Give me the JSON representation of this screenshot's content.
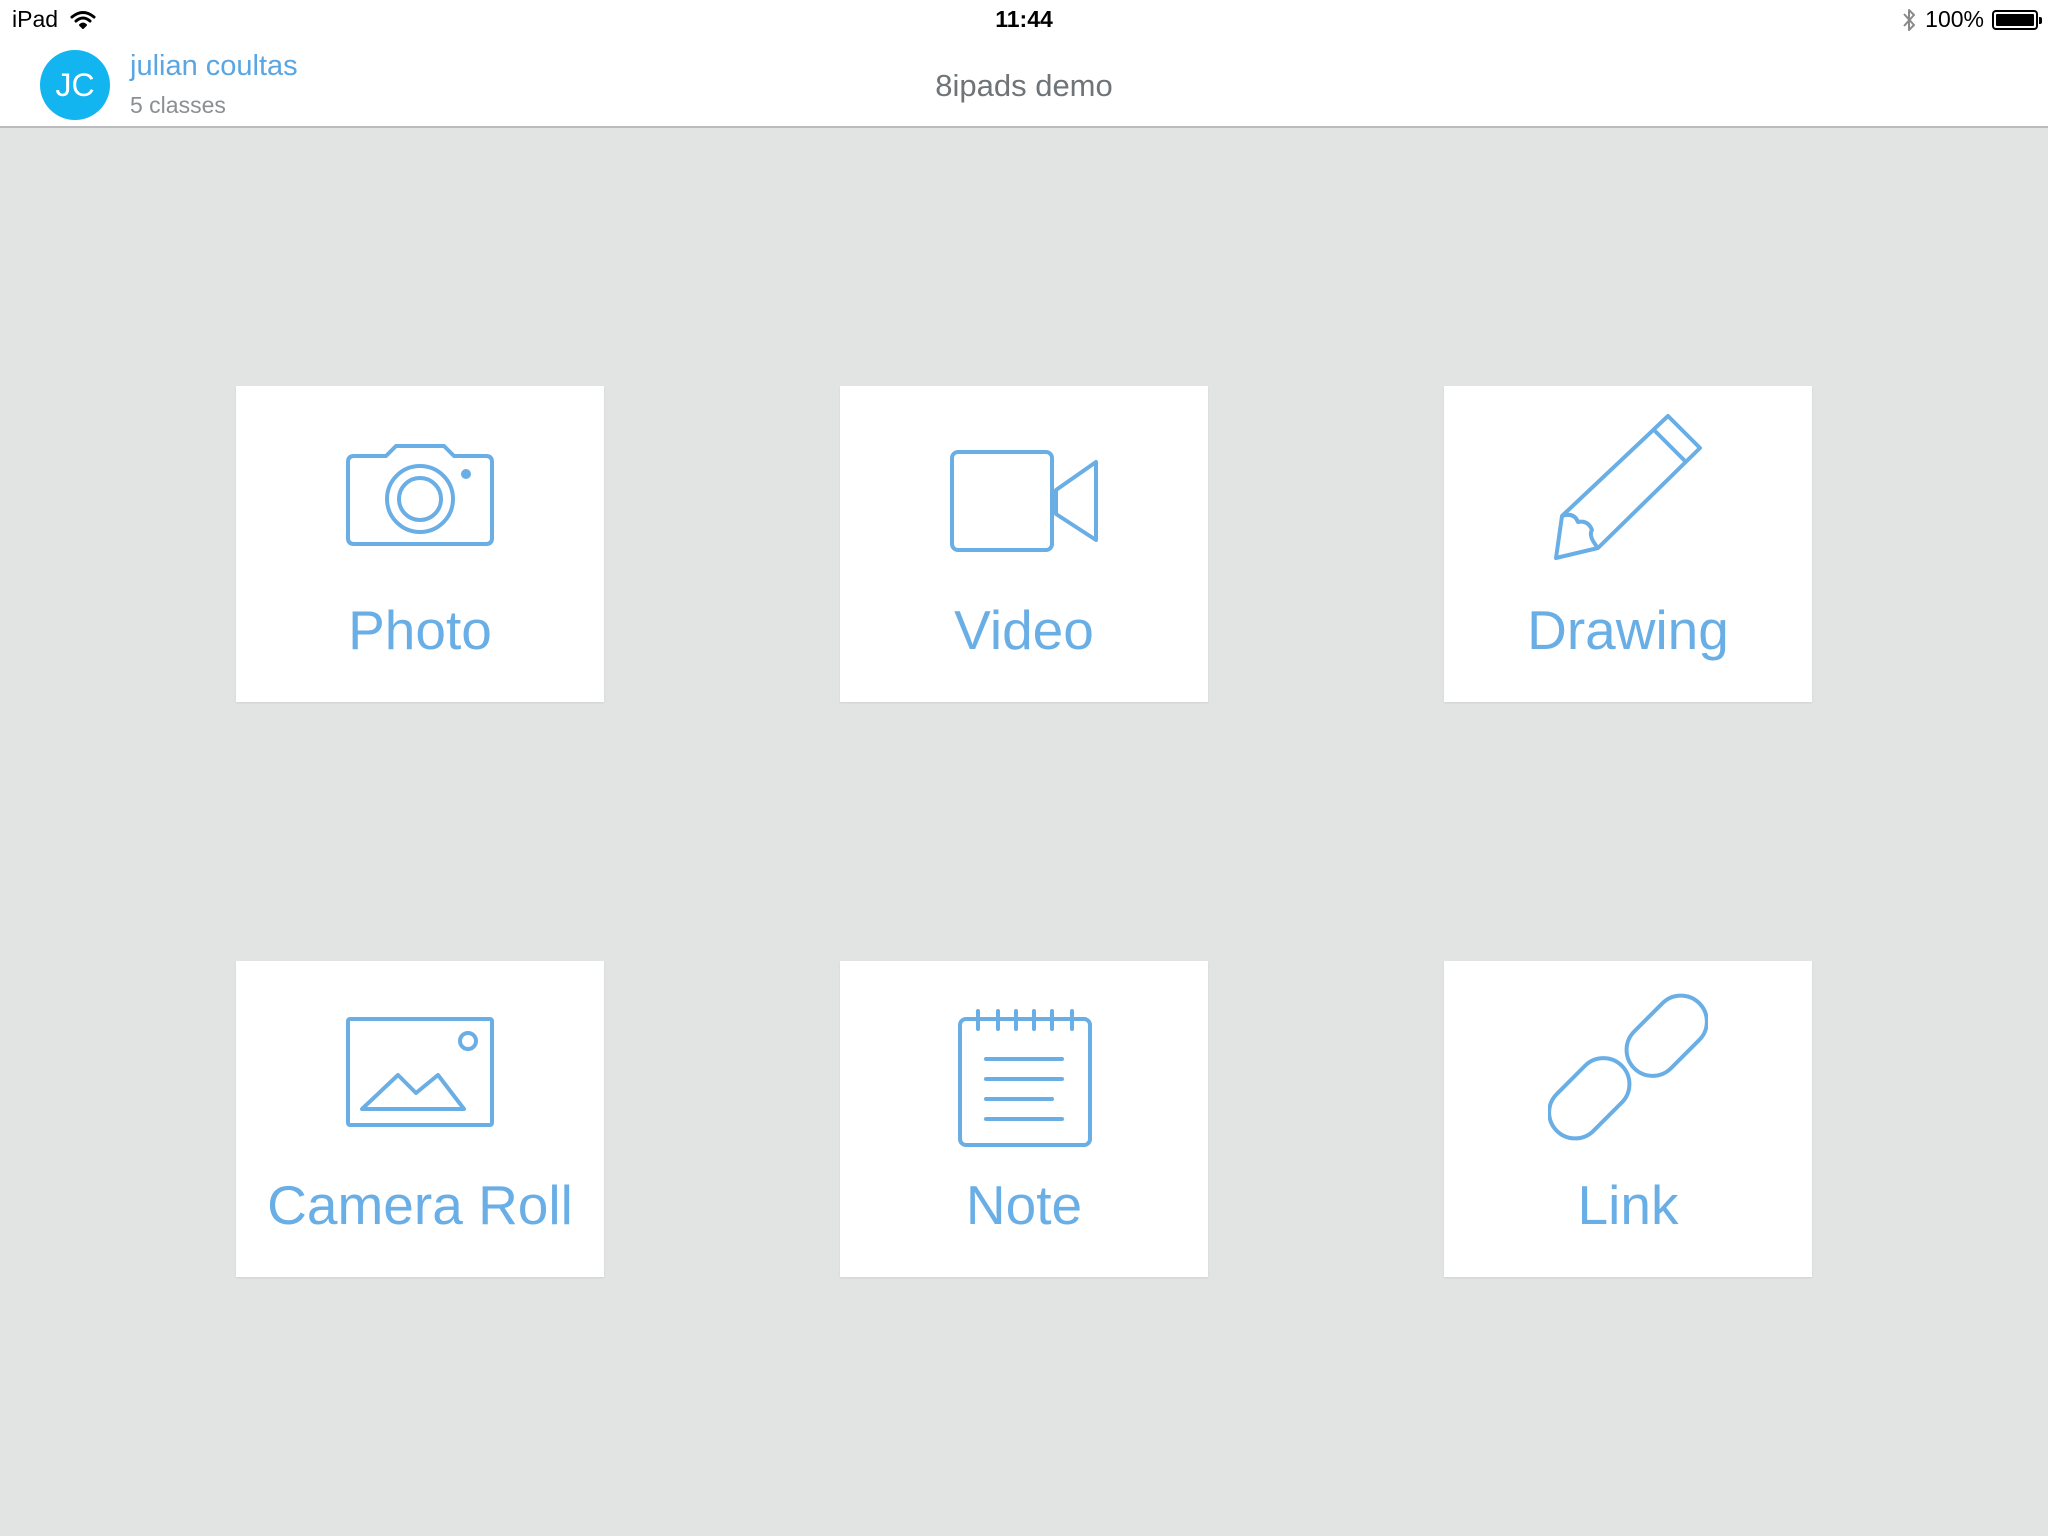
{
  "status_bar": {
    "device": "iPad",
    "time": "11:44",
    "battery": "100%",
    "battery_level": 1.0
  },
  "header": {
    "avatar_initials": "JC",
    "user_name": "julian coultas",
    "user_subtitle": "5 classes",
    "title": "8ipads demo"
  },
  "tiles": [
    {
      "label": "Photo",
      "icon": "camera-icon"
    },
    {
      "label": "Video",
      "icon": "video-camera-icon"
    },
    {
      "label": "Drawing",
      "icon": "pencil-icon"
    },
    {
      "label": "Camera Roll",
      "icon": "image-icon"
    },
    {
      "label": "Note",
      "icon": "notepad-icon"
    },
    {
      "label": "Link",
      "icon": "link-icon"
    }
  ],
  "colors": {
    "accent": "#6aaee6",
    "avatar": "#12b5f0",
    "background": "#e2e4e3"
  }
}
